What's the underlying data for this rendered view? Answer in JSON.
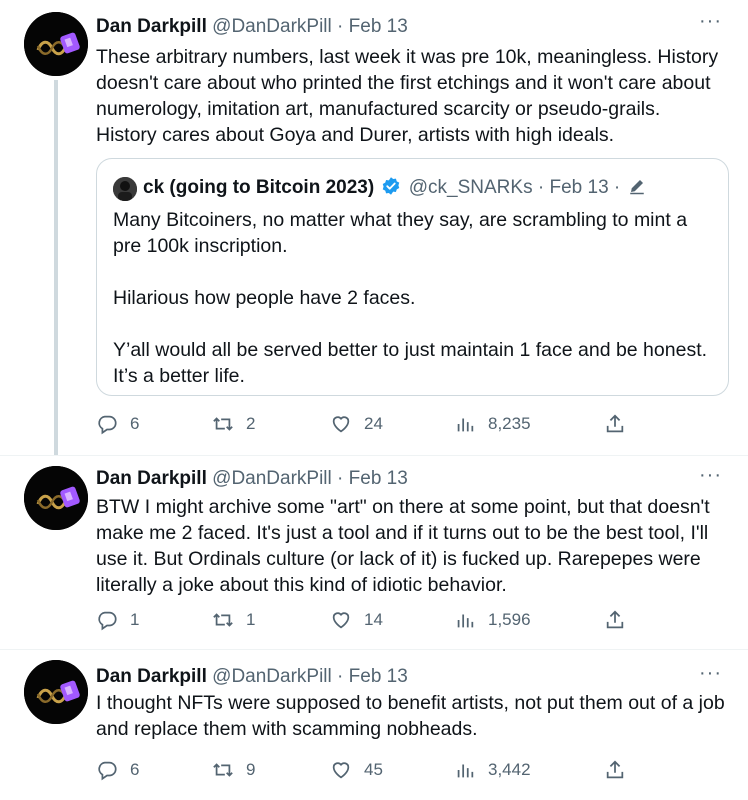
{
  "tweets": [
    {
      "name": "Dan Darkpill",
      "handle": "@DanDarkPill",
      "sep": "·",
      "date": "Feb 13",
      "more": "···",
      "lines": [
        "These arbitrary numbers, last week it was pre 10k, meaningless. History",
        "doesn't care about who printed the first etchings and it won't care about",
        "numerology, imitation art, manufactured scarcity or pseudo-grails.",
        "History cares about Goya and Durer, artists with high ideals."
      ],
      "quote": {
        "name": "ck (going to Bitcoin 2023)",
        "handle": "@ck_SNARKs",
        "sep": "·",
        "date": "Feb 13",
        "sep2": "·",
        "paragraphs": [
          [
            "Many Bitcoiners, no matter what they say, are scrambling to mint a",
            "pre 100k inscription."
          ],
          [
            "Hilarious how people have 2 faces."
          ],
          [
            "Y’all would all be served better to just maintain 1 face and be honest.",
            "It’s a better life."
          ]
        ]
      },
      "stats": {
        "replies": "6",
        "retweets": "2",
        "likes": "24",
        "views": "8,235"
      }
    },
    {
      "name": "Dan Darkpill",
      "handle": "@DanDarkPill",
      "sep": "·",
      "date": "Feb 13",
      "more": "···",
      "lines": [
        "BTW I might archive some \"art\" on there at some point, but that doesn't",
        "make me 2 faced. It's just a tool and if it turns out to be the best tool, I'll",
        "use it.  But Ordinals culture (or lack of it) is fucked up. Rarepepes were",
        "literally a joke about this kind of idiotic behavior."
      ],
      "stats": {
        "replies": "1",
        "retweets": "1",
        "likes": "14",
        "views": "1,596"
      }
    },
    {
      "name": "Dan Darkpill",
      "handle": "@DanDarkPill",
      "sep": "·",
      "date": "Feb 13",
      "more": "···",
      "lines": [
        "I thought NFTs were supposed to benefit artists, not put them out of a job",
        "and replace them with scamming nobheads."
      ],
      "stats": {
        "replies": "6",
        "retweets": "9",
        "likes": "45",
        "views": "3,442"
      }
    }
  ],
  "icons": {
    "reply": "reply-icon",
    "retweet": "retweet-icon",
    "like": "heart-icon",
    "views": "views-bar-chart-icon",
    "share": "share-icon",
    "verified": "verified-badge-icon",
    "edited": "edited-pen-icon"
  },
  "colors": {
    "text": "#0f1419",
    "muted": "#536471",
    "border": "#cfd9de",
    "verified": "#1d9bf0",
    "avatar_accent": "#a259ff"
  }
}
